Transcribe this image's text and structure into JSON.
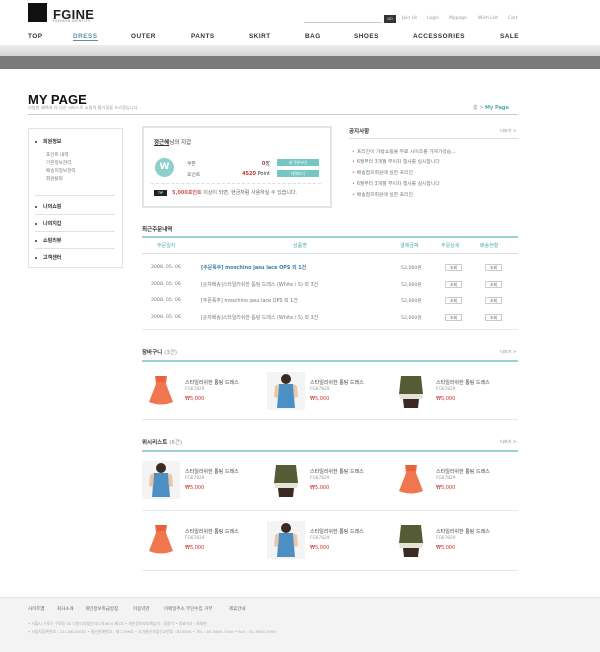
{
  "brand": {
    "name": "FGINE",
    "tagline": "FASHION IDENTITY"
  },
  "search": {
    "button": "GO"
  },
  "util_links": [
    "Join Us",
    "Login",
    "Mypage",
    "Wish List",
    "Cart"
  ],
  "nav": [
    "TOP",
    "DRESS",
    "OUTER",
    "PANTS",
    "SKIRT",
    "BAG",
    "SHOES",
    "ACCESSORIES",
    "SALE"
  ],
  "page": {
    "title": "MY PAGE",
    "subtitle": "다양한 혜택과 더 나은 서비스로 쇼핑의 즐거움을 드리겠습니다",
    "crumb_home": "홈",
    "crumb_sep": ">",
    "crumb_current": "My Page"
  },
  "sidebar": {
    "groups": [
      {
        "label": "회원정보",
        "subs": [
          "포인트 내역",
          "기본정보관리",
          "배송지정보관리",
          "회원탈퇴"
        ]
      },
      {
        "label": "나의쇼핑",
        "subs": []
      },
      {
        "label": "나의지갑",
        "subs": []
      },
      {
        "label": "쇼핑리뷰",
        "subs": []
      },
      {
        "label": "고객센터",
        "subs": []
      }
    ]
  },
  "wallet": {
    "user": "정근혜",
    "title_suffix": "님의 지갑",
    "badge": "W",
    "coupon_label": "쿠폰",
    "coupon_value": "0",
    "coupon_unit": "장",
    "point_label": "포인트",
    "point_value": "4520",
    "point_unit": " Point",
    "coupon_btn": "내 쿠폰보기",
    "point_btn": "내역보기",
    "tip_badge": "TIP",
    "tip_amount": "5,000포인트",
    "tip_text": " 이상이 되면, 현금처럼 사용하실 수 있습니다."
  },
  "notice": {
    "title": "공지사항",
    "more": "더보기 >",
    "items": [
      "프리진이 가방쇼핑몰 무료 사이즈를 가져가셨습...",
      "6월부터 3개월 무이자 행사를 실시합니다",
      "배송접지회원에 실한 프리진",
      "6월부터 3개월 무이자 행사를 실시합니다",
      "배송접지회원에 실한 프리진"
    ]
  },
  "orders": {
    "title": "최근주문내역",
    "headers": [
      "주문일자",
      "상품명",
      "결제금액",
      "주문상세",
      "배송현황"
    ],
    "rows": [
      {
        "date": "2008. 05. 06",
        "name": "[주문폭주] moschino jasu lace OPS 외 1건",
        "price": "52,000원",
        "detail": "조회",
        "ship": "조회"
      },
      {
        "date": "2008. 05. 06",
        "name": "[순차배송]스타일리쉬한 톱팅 드레스 (White / S) 외 3건",
        "price": "52,000원",
        "detail": "조회",
        "ship": "조회"
      },
      {
        "date": "2008. 05. 06",
        "name": "[주문폭주] moschino jasu lace OPS 외 1건",
        "price": "52,000원",
        "detail": "조회",
        "ship": "조회"
      },
      {
        "date": "2008. 05. 06",
        "name": "[순차배송]스타일리쉬한 톱팅 드레스 (White / S) 외 3건",
        "price": "52,000원",
        "detail": "조회",
        "ship": "조회"
      }
    ]
  },
  "cart": {
    "title": "장바구니",
    "count": "(3건)",
    "more": "더보기 >",
    "items": [
      {
        "name": "스타일리쉬한 톱팅 드레스",
        "code": "FG67829",
        "price": "₩5,000",
        "img": "orange"
      },
      {
        "name": "스타일리쉬한 톱팅 드레스",
        "code": "FG67829",
        "price": "₩5,000",
        "img": "blue"
      },
      {
        "name": "스타일리쉬한 톱팅 드레스",
        "code": "FG67829",
        "price": "₩5,000",
        "img": "olive"
      }
    ]
  },
  "wishlist": {
    "title": "위시리스트",
    "count": "(6건)",
    "more": "더보기 >",
    "items": [
      {
        "name": "스타일리쉬한 톱팅 드레스",
        "code": "FG67829",
        "price": "₩5,000",
        "img": "blue"
      },
      {
        "name": "스타일리쉬한 톱팅 드레스",
        "code": "FG67829",
        "price": "₩5,000",
        "img": "olive"
      },
      {
        "name": "스타일리쉬한 톱팅 드레스",
        "code": "FG67829",
        "price": "₩5,000",
        "img": "orange"
      },
      {
        "name": "스타일리쉬한 톱팅 드레스",
        "code": "FG67829",
        "price": "₩5,000",
        "img": "orange"
      },
      {
        "name": "스타일리쉬한 톱팅 드레스",
        "code": "FG67829",
        "price": "₩5,000",
        "img": "blue"
      },
      {
        "name": "스타일리쉬한 톱팅 드레스",
        "code": "FG67829",
        "price": "₩5,000",
        "img": "olive"
      }
    ]
  },
  "footer": {
    "links": [
      "사이트맵",
      "회사소개",
      "개인정보취급방침",
      "이용약관",
      "이메일주소 무단수집 거부",
      "제휴안내"
    ],
    "info": [
      "• 서울시 구로구 구로동 00 다원디지털단지(1차)605 제1호    • 개인정보보호책임자 : 정창석    • 대표이사 : 최재현",
      "• 사업자등록번호 : 211-88-00001    • 통신판매번호 : 제 1799호    • 부가통신사업신고번호 : 810004    • TEL : 02-3605-7000    • FAX : 02-3605-7099"
    ]
  },
  "colors": {
    "accent": "#5aa9a8",
    "teal_btn": "#76c6c3",
    "price": "#cc3333",
    "link": "#3d7da1"
  }
}
